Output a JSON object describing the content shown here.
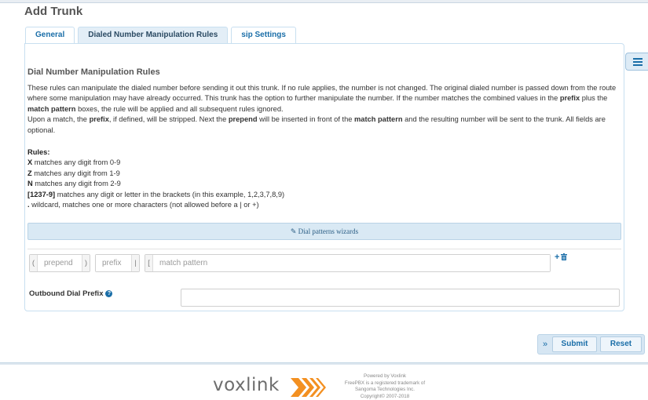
{
  "page": {
    "title": "Add Trunk"
  },
  "tabs": [
    {
      "label": "General"
    },
    {
      "label": "Dialed Number Manipulation Rules"
    },
    {
      "label": "sip Settings"
    }
  ],
  "section": {
    "heading": "Dial Number Manipulation Rules",
    "p1_a": "These rules can manipulate the dialed number before sending it out this trunk. If no rule applies, the number is not changed. The original dialed number is passed down from the route where some manipulation may have already occurred. This trunk has the option to further manipulate the number. If the number matches the combined values in the ",
    "p1_b": "prefix",
    "p1_c": " plus the ",
    "p1_d": "match pattern",
    "p1_e": " boxes, the rule will be applied and all subsequent rules ignored.",
    "p2_a": "Upon a match, the ",
    "p2_b": "prefix",
    "p2_c": ", if defined, will be stripped. Next the ",
    "p2_d": "prepend",
    "p2_e": " will be inserted in front of the ",
    "p2_f": "match pattern",
    "p2_g": " and the resulting number will be sent to the trunk. All fields are optional."
  },
  "rules": {
    "heading": "Rules:",
    "items": [
      {
        "key": "X",
        "text": "  matches any digit from 0-9"
      },
      {
        "key": "Z",
        "text": "  matches any digit from 1-9"
      },
      {
        "key": "N",
        "text": "  matches any digit from 2-9"
      },
      {
        "key": "[1237-9]",
        "text": " matches any digit or letter in the brackets (in this example, 1,2,3,7,8,9)"
      },
      {
        "key": ".",
        "text": "  wildcard, matches one or more characters (not allowed before a | or +)"
      }
    ]
  },
  "wizard": {
    "label": "Dial patterns wizards",
    "icon": "pencil-icon"
  },
  "pattern_row": {
    "prepend_open": "(",
    "prepend_close": ")",
    "prepend_placeholder": "prepend",
    "prefix_placeholder": "prefix",
    "prefix_sep": "|",
    "match_open": "[",
    "match_placeholder": "match pattern",
    "add_icon": "+",
    "delete_icon": "trash-icon"
  },
  "outbound": {
    "label": "Outbound Dial Prefix",
    "help_icon": "?",
    "value": ""
  },
  "actions": {
    "chevron": "»",
    "submit": "Submit",
    "reset": "Reset"
  },
  "footer": {
    "logo": "voxlink",
    "line1": "Powered by Voxlink",
    "line2": "FreePBX is a registered trademark of",
    "line3": "Sangoma Technologies Inc.",
    "line4": "Copyright© 2007-2018"
  },
  "colors": {
    "accent": "#1a6ea8",
    "logo_orange": "#f39021",
    "tab_active": "#e3eef7"
  }
}
